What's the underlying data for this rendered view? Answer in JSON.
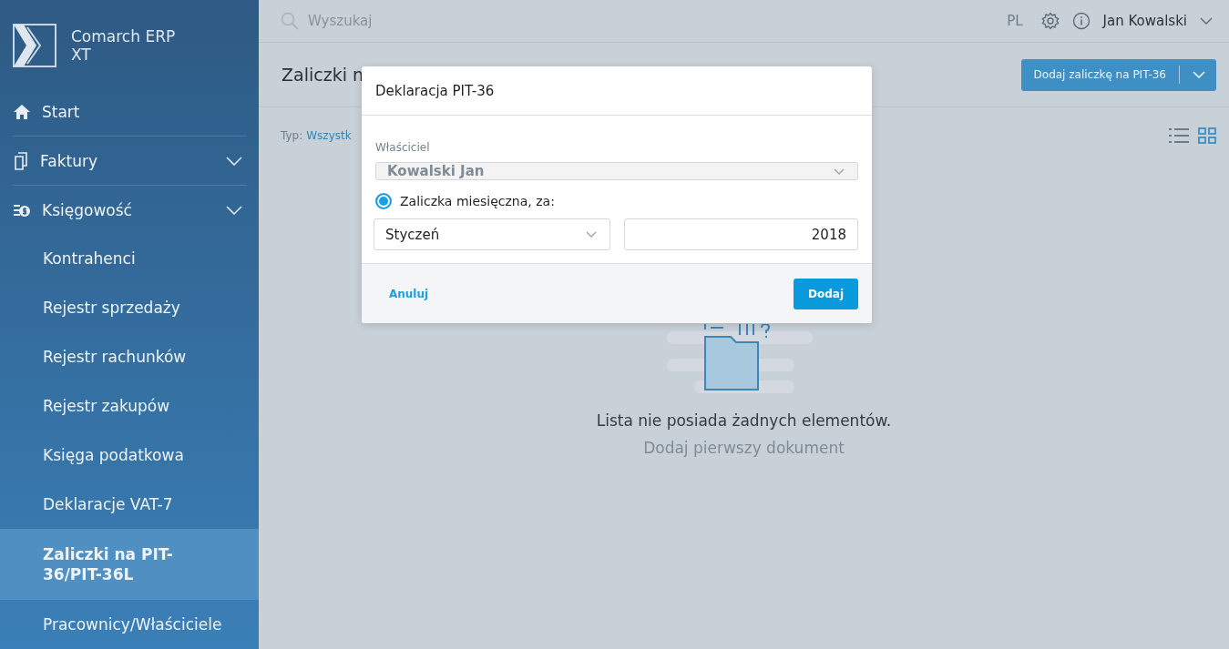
{
  "app": {
    "name": "Comarch ERP XT"
  },
  "sidebar": {
    "items": [
      {
        "label": "Start",
        "kind": "home",
        "selected": false
      },
      {
        "label": "Faktury",
        "kind": "documents",
        "selected": false
      },
      {
        "label": "Księgowość",
        "kind": "money",
        "selected": false,
        "children": [
          {
            "label": "Kontrahenci",
            "selected": false
          },
          {
            "label": "Rejestr sprzedaży",
            "selected": false
          },
          {
            "label": "Rejestr rachunków",
            "selected": false
          },
          {
            "label": "Rejestr zakupów",
            "selected": false
          },
          {
            "label": "Księga podatkowa",
            "selected": false
          },
          {
            "label": "Deklaracje VAT-7",
            "selected": false
          },
          {
            "label": "Zaliczki na PIT-36/PIT-36L",
            "selected": true
          },
          {
            "label": "Pracownicy/Właściciele",
            "selected": false
          }
        ]
      }
    ]
  },
  "topbar": {
    "search_placeholder": "Wyszukaj",
    "language": "PL",
    "user": "Jan Kowalski"
  },
  "page": {
    "title": "Zaliczki n",
    "add_button": "Dodaj zaliczkę na PIT-36",
    "filter_label": "Typ:",
    "filter_value": "Wszystk",
    "empty_title": "Lista nie posiada żadnych elementów.",
    "empty_link": "Dodaj pierwszy dokument"
  },
  "dialog": {
    "title": "Deklaracja PIT-36",
    "owner_label": "Właściciel",
    "owner_value": "Kowalski Jan",
    "owner_disabled": true,
    "radio_label": "Zaliczka miesięczna, za:",
    "radio_selected": true,
    "month": "Styczeń",
    "year": "2018",
    "cancel": "Anuluj",
    "confirm": "Dodaj"
  }
}
